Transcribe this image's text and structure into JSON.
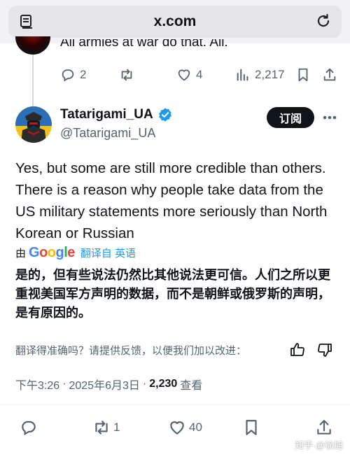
{
  "browser": {
    "url": "x.com",
    "tab_icon": "tabs-icon",
    "reload_icon": "reload-icon"
  },
  "previous_tweet": {
    "text": "All armies at war do that. All.",
    "replies": "2",
    "retweets": "",
    "likes": "4",
    "views": "2,217"
  },
  "tweet": {
    "display_name": "Tatarigami_UA",
    "handle": "@Tatarigami_UA",
    "subscribe_label": "订阅",
    "text": "Yes, but some are still more credible than others. There is a reason why people take data from the US military statements more seriously than North Korean or Russian",
    "translated_by_prefix": "由",
    "translated_by_brand": "Google",
    "translate_from": "翻译自 英语",
    "translated_text": "是的，但有些说法仍然比其他说法更可信。人们之所以更重视美国军方声明的数据，而不是朝鲜或俄罗斯的声明，是有原因的。",
    "feedback_prompt": "翻译得准确吗？请提供反馈，以便我们加以改进：",
    "time": "下午3:26",
    "separator": "·",
    "date": "2025年6月3日",
    "views_count": "2,230",
    "views_label": "查看",
    "replies": "",
    "retweets": "1",
    "likes": "40"
  },
  "watermark": "知乎 @徐旭",
  "colors": {
    "accent": "#1d9bf0",
    "text": "#0f1419",
    "secondary": "#536471",
    "google_blue": "#4285f4",
    "google_red": "#ea4335",
    "google_yellow": "#fbbc05",
    "google_green": "#34a853"
  }
}
